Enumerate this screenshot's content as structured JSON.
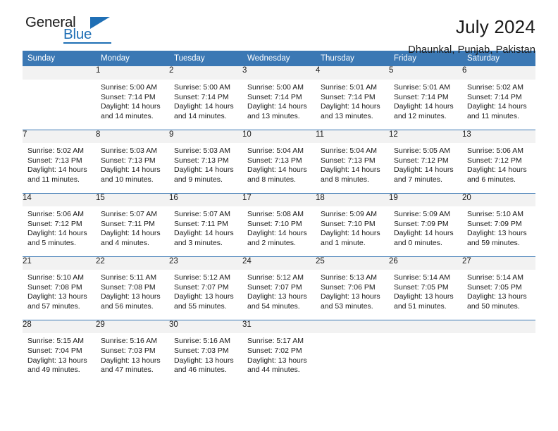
{
  "brand": {
    "line1": "General",
    "line2": "Blue",
    "accent_color": "#1f6fb5"
  },
  "header": {
    "title": "July 2024",
    "location": "Dhaunkal, Punjab, Pakistan",
    "header_bg": "#3b78b4",
    "daynum_bg": "#f2f2f2"
  },
  "weekdays": [
    "Sunday",
    "Monday",
    "Tuesday",
    "Wednesday",
    "Thursday",
    "Friday",
    "Saturday"
  ],
  "labels": {
    "sunrise": "Sunrise:",
    "sunset": "Sunset:",
    "daylight": "Daylight:"
  },
  "weeks": [
    [
      {
        "day": "",
        "sunrise": "",
        "sunset": "",
        "daylight1": "",
        "daylight2": ""
      },
      {
        "day": "1",
        "sunrise": "Sunrise: 5:00 AM",
        "sunset": "Sunset: 7:14 PM",
        "daylight1": "Daylight: 14 hours",
        "daylight2": "and 14 minutes."
      },
      {
        "day": "2",
        "sunrise": "Sunrise: 5:00 AM",
        "sunset": "Sunset: 7:14 PM",
        "daylight1": "Daylight: 14 hours",
        "daylight2": "and 14 minutes."
      },
      {
        "day": "3",
        "sunrise": "Sunrise: 5:00 AM",
        "sunset": "Sunset: 7:14 PM",
        "daylight1": "Daylight: 14 hours",
        "daylight2": "and 13 minutes."
      },
      {
        "day": "4",
        "sunrise": "Sunrise: 5:01 AM",
        "sunset": "Sunset: 7:14 PM",
        "daylight1": "Daylight: 14 hours",
        "daylight2": "and 13 minutes."
      },
      {
        "day": "5",
        "sunrise": "Sunrise: 5:01 AM",
        "sunset": "Sunset: 7:14 PM",
        "daylight1": "Daylight: 14 hours",
        "daylight2": "and 12 minutes."
      },
      {
        "day": "6",
        "sunrise": "Sunrise: 5:02 AM",
        "sunset": "Sunset: 7:14 PM",
        "daylight1": "Daylight: 14 hours",
        "daylight2": "and 11 minutes."
      }
    ],
    [
      {
        "day": "7",
        "sunrise": "Sunrise: 5:02 AM",
        "sunset": "Sunset: 7:13 PM",
        "daylight1": "Daylight: 14 hours",
        "daylight2": "and 11 minutes."
      },
      {
        "day": "8",
        "sunrise": "Sunrise: 5:03 AM",
        "sunset": "Sunset: 7:13 PM",
        "daylight1": "Daylight: 14 hours",
        "daylight2": "and 10 minutes."
      },
      {
        "day": "9",
        "sunrise": "Sunrise: 5:03 AM",
        "sunset": "Sunset: 7:13 PM",
        "daylight1": "Daylight: 14 hours",
        "daylight2": "and 9 minutes."
      },
      {
        "day": "10",
        "sunrise": "Sunrise: 5:04 AM",
        "sunset": "Sunset: 7:13 PM",
        "daylight1": "Daylight: 14 hours",
        "daylight2": "and 8 minutes."
      },
      {
        "day": "11",
        "sunrise": "Sunrise: 5:04 AM",
        "sunset": "Sunset: 7:13 PM",
        "daylight1": "Daylight: 14 hours",
        "daylight2": "and 8 minutes."
      },
      {
        "day": "12",
        "sunrise": "Sunrise: 5:05 AM",
        "sunset": "Sunset: 7:12 PM",
        "daylight1": "Daylight: 14 hours",
        "daylight2": "and 7 minutes."
      },
      {
        "day": "13",
        "sunrise": "Sunrise: 5:06 AM",
        "sunset": "Sunset: 7:12 PM",
        "daylight1": "Daylight: 14 hours",
        "daylight2": "and 6 minutes."
      }
    ],
    [
      {
        "day": "14",
        "sunrise": "Sunrise: 5:06 AM",
        "sunset": "Sunset: 7:12 PM",
        "daylight1": "Daylight: 14 hours",
        "daylight2": "and 5 minutes."
      },
      {
        "day": "15",
        "sunrise": "Sunrise: 5:07 AM",
        "sunset": "Sunset: 7:11 PM",
        "daylight1": "Daylight: 14 hours",
        "daylight2": "and 4 minutes."
      },
      {
        "day": "16",
        "sunrise": "Sunrise: 5:07 AM",
        "sunset": "Sunset: 7:11 PM",
        "daylight1": "Daylight: 14 hours",
        "daylight2": "and 3 minutes."
      },
      {
        "day": "17",
        "sunrise": "Sunrise: 5:08 AM",
        "sunset": "Sunset: 7:10 PM",
        "daylight1": "Daylight: 14 hours",
        "daylight2": "and 2 minutes."
      },
      {
        "day": "18",
        "sunrise": "Sunrise: 5:09 AM",
        "sunset": "Sunset: 7:10 PM",
        "daylight1": "Daylight: 14 hours",
        "daylight2": "and 1 minute."
      },
      {
        "day": "19",
        "sunrise": "Sunrise: 5:09 AM",
        "sunset": "Sunset: 7:09 PM",
        "daylight1": "Daylight: 14 hours",
        "daylight2": "and 0 minutes."
      },
      {
        "day": "20",
        "sunrise": "Sunrise: 5:10 AM",
        "sunset": "Sunset: 7:09 PM",
        "daylight1": "Daylight: 13 hours",
        "daylight2": "and 59 minutes."
      }
    ],
    [
      {
        "day": "21",
        "sunrise": "Sunrise: 5:10 AM",
        "sunset": "Sunset: 7:08 PM",
        "daylight1": "Daylight: 13 hours",
        "daylight2": "and 57 minutes."
      },
      {
        "day": "22",
        "sunrise": "Sunrise: 5:11 AM",
        "sunset": "Sunset: 7:08 PM",
        "daylight1": "Daylight: 13 hours",
        "daylight2": "and 56 minutes."
      },
      {
        "day": "23",
        "sunrise": "Sunrise: 5:12 AM",
        "sunset": "Sunset: 7:07 PM",
        "daylight1": "Daylight: 13 hours",
        "daylight2": "and 55 minutes."
      },
      {
        "day": "24",
        "sunrise": "Sunrise: 5:12 AM",
        "sunset": "Sunset: 7:07 PM",
        "daylight1": "Daylight: 13 hours",
        "daylight2": "and 54 minutes."
      },
      {
        "day": "25",
        "sunrise": "Sunrise: 5:13 AM",
        "sunset": "Sunset: 7:06 PM",
        "daylight1": "Daylight: 13 hours",
        "daylight2": "and 53 minutes."
      },
      {
        "day": "26",
        "sunrise": "Sunrise: 5:14 AM",
        "sunset": "Sunset: 7:05 PM",
        "daylight1": "Daylight: 13 hours",
        "daylight2": "and 51 minutes."
      },
      {
        "day": "27",
        "sunrise": "Sunrise: 5:14 AM",
        "sunset": "Sunset: 7:05 PM",
        "daylight1": "Daylight: 13 hours",
        "daylight2": "and 50 minutes."
      }
    ],
    [
      {
        "day": "28",
        "sunrise": "Sunrise: 5:15 AM",
        "sunset": "Sunset: 7:04 PM",
        "daylight1": "Daylight: 13 hours",
        "daylight2": "and 49 minutes."
      },
      {
        "day": "29",
        "sunrise": "Sunrise: 5:16 AM",
        "sunset": "Sunset: 7:03 PM",
        "daylight1": "Daylight: 13 hours",
        "daylight2": "and 47 minutes."
      },
      {
        "day": "30",
        "sunrise": "Sunrise: 5:16 AM",
        "sunset": "Sunset: 7:03 PM",
        "daylight1": "Daylight: 13 hours",
        "daylight2": "and 46 minutes."
      },
      {
        "day": "31",
        "sunrise": "Sunrise: 5:17 AM",
        "sunset": "Sunset: 7:02 PM",
        "daylight1": "Daylight: 13 hours",
        "daylight2": "and 44 minutes."
      },
      {
        "day": "",
        "sunrise": "",
        "sunset": "",
        "daylight1": "",
        "daylight2": ""
      },
      {
        "day": "",
        "sunrise": "",
        "sunset": "",
        "daylight1": "",
        "daylight2": ""
      },
      {
        "day": "",
        "sunrise": "",
        "sunset": "",
        "daylight1": "",
        "daylight2": ""
      }
    ]
  ]
}
